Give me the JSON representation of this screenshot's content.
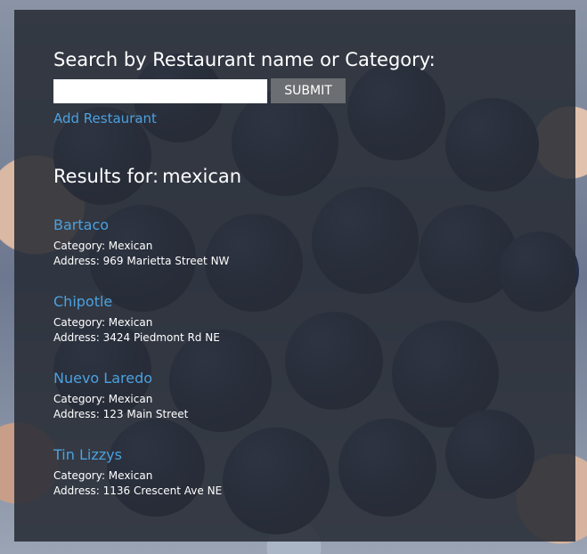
{
  "search": {
    "title": "Search by Restaurant name or Category:",
    "placeholder": "",
    "value": "",
    "submit_label": "SUBMIT"
  },
  "add_restaurant_label": "Add Restaurant",
  "results_label": "Results for:",
  "query": "mexican",
  "results": [
    {
      "name": "Bartaco",
      "category": "Category: Mexican",
      "address": "Address: 969 Marietta Street NW"
    },
    {
      "name": "Chipotle",
      "category": "Category: Mexican",
      "address": "Address: 3424 Piedmont Rd NE"
    },
    {
      "name": "Nuevo Laredo",
      "category": "Category: Mexican",
      "address": "Address: 123 Main Street"
    },
    {
      "name": "Tin Lizzys",
      "category": "Category: Mexican",
      "address": "Address: 1136 Crescent Ave NE"
    }
  ],
  "colors": {
    "link": "#4ba1df",
    "panel": "rgba(40,44,54,0.88)",
    "button": "#6b6e72",
    "text": "#ffffff"
  }
}
